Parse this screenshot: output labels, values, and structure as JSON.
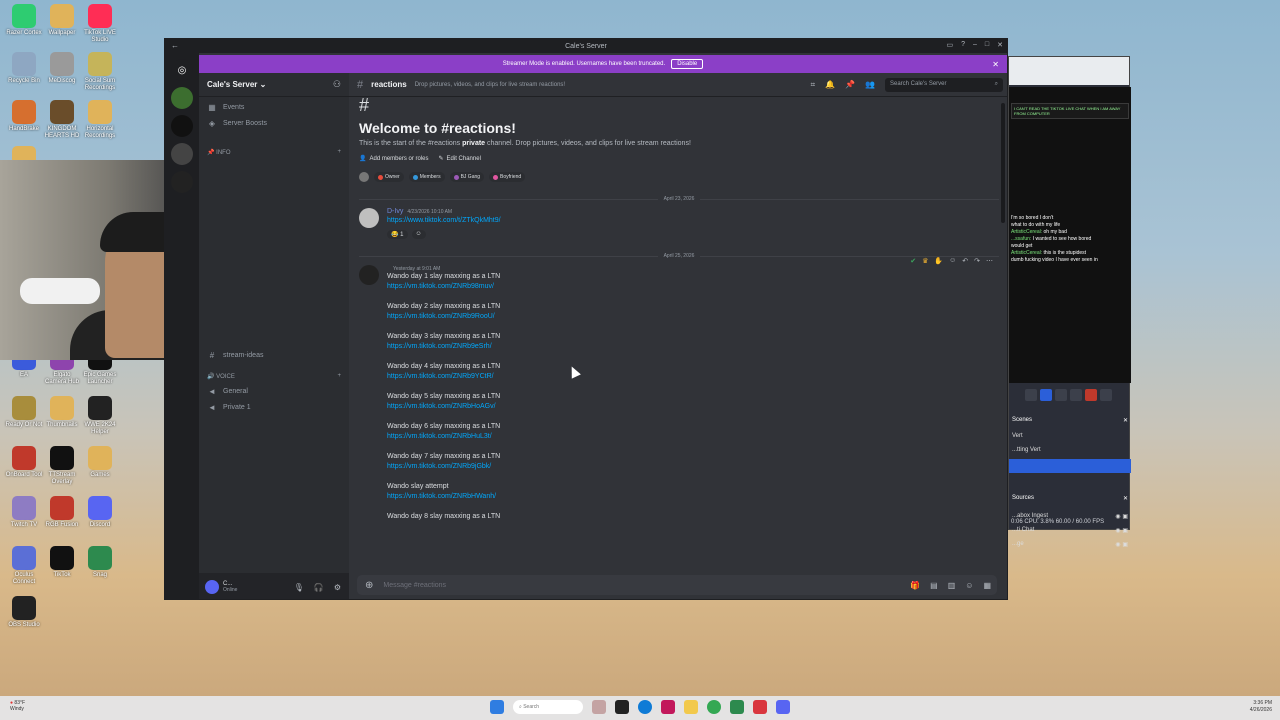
{
  "desktop": {
    "icons": [
      {
        "label": "Razer Cortex",
        "color": "#2ecc71"
      },
      {
        "label": "Wallpaper",
        "color": "#e0b35a"
      },
      {
        "label": "TikTok LIVE Studio",
        "color": "#ff2d55"
      },
      {
        "label": "Recycle Bin",
        "color": "#8ea7c2"
      },
      {
        "label": "MeDiscog",
        "color": "#9a9a9a"
      },
      {
        "label": "Social Sum Recordings",
        "color": "#c5b45a"
      },
      {
        "label": "HandBrake",
        "color": "#d66f2f"
      },
      {
        "label": "KINGDOM HEARTS HD",
        "color": "#6a4d2a"
      },
      {
        "label": "Horizontal Recordings",
        "color": "#e0b35a"
      },
      {
        "label": "Vertical Recordings",
        "color": "#e0b35a"
      },
      {
        "label": "EA",
        "color": "#3b5bdb"
      },
      {
        "label": "Elgato Camera Hub",
        "color": "#8e44ad"
      },
      {
        "label": "Epic Games Launcher",
        "color": "#111111"
      },
      {
        "label": "Ready Or Not",
        "color": "#a88d3c"
      },
      {
        "label": "Thumbnails",
        "color": "#e0b35a"
      },
      {
        "label": "WWE 2K24 Helper",
        "color": "#222222"
      },
      {
        "label": "OnBoard Tool",
        "color": "#c0392b"
      },
      {
        "label": "TTStream Overlay",
        "color": "#111111"
      },
      {
        "label": "Games",
        "color": "#e0b35a"
      },
      {
        "label": "Twitch TV",
        "color": "#8e7cc3"
      },
      {
        "label": "RGB Fusion",
        "color": "#c0392b"
      },
      {
        "label": "Discord",
        "color": "#5865f2"
      },
      {
        "label": "Oculus Connect",
        "color": "#5b6fd6"
      },
      {
        "label": "TikTok",
        "color": "#111111"
      },
      {
        "label": "Snag",
        "color": "#2d8a4e"
      },
      {
        "label": "OBS Studio",
        "color": "#222222"
      }
    ]
  },
  "obs": {
    "chat": [
      {
        "user": "",
        "text": "I'm so bored I don't"
      },
      {
        "user": "",
        "text": "what to do with my life"
      },
      {
        "user": "ArtisticCereal:",
        "text": "oh my bad"
      },
      {
        "user": "...ssafun:",
        "text": "I wanted to see how bored"
      },
      {
        "user": "",
        "text": "would get"
      },
      {
        "user": "ArtisticCereal:",
        "text": "this is the stupidest"
      },
      {
        "user": "",
        "text": "dumb fucking video I have ever seen in"
      }
    ],
    "banner": "I CAN'T READ THE TIKTOK LIVE CHAT WHEN I AM AWAY FROM COMPUTER",
    "scenes_title": "Scenes",
    "scenes": [
      "Vert",
      "...tting Vert",
      ""
    ],
    "sources_title": "Sources",
    "sources": [
      "...abox Ingest",
      "...ti Chat",
      "...ge"
    ],
    "stats": {
      "time": "0:06",
      "cpu": "CPU: 3.8%",
      "fps": "60.00 / 60.00 FPS"
    }
  },
  "discord": {
    "window_title": "Cale's Server",
    "streamer_banner": "Streamer Mode is enabled. Usernames have been truncated.",
    "disable_label": "Disable",
    "server_name": "Cale's Server",
    "channels": {
      "top": [
        {
          "icon": "calendar-icon",
          "glyph": "▦",
          "label": "Events"
        },
        {
          "icon": "boost-icon",
          "glyph": "◈",
          "label": "Server Boosts"
        }
      ],
      "info_category": "INFO",
      "text_items": [
        {
          "label": "stream-ideas"
        }
      ],
      "voice_category": "VOICE",
      "voice_items": [
        {
          "label": "General"
        },
        {
          "label": "Private 1"
        }
      ]
    },
    "user": {
      "name": "C...",
      "status": "Online"
    },
    "channel": {
      "name": "reactions",
      "topic": "Drop pictures, videos, and clips for live stream reactions!",
      "search_placeholder": "Search Cale's Server"
    },
    "welcome": {
      "title": "Welcome to #reactions!",
      "start_prefix": "This is the start of the #reactions ",
      "start_bold": "private",
      "start_suffix": " channel. Drop pictures, videos, and clips for live stream reactions!",
      "add_members": "Add members or roles",
      "edit_channel": "Edit Channel",
      "roles": [
        {
          "name": "Owner",
          "color": "#e74c3c"
        },
        {
          "name": "Members",
          "color": "#3498db"
        },
        {
          "name": "BJ Gang",
          "color": "#9b59b6"
        },
        {
          "name": "Boyfriend",
          "color": "#e056a0"
        }
      ]
    },
    "dividers": {
      "first": "April 23, 2026",
      "second": "April 25, 2026"
    },
    "first_message": {
      "author": "D-Ivy",
      "time": "4/23/2026 10:10 AM",
      "link": "https://www.tiktok.com/t/ZTkQkMht9/",
      "reactions": [
        "1"
      ]
    },
    "second_message": {
      "time": "Yesterday at 9:01 AM",
      "entries": [
        {
          "text": "Wando day 1 slay maxxing as a LTN",
          "link": "https://vm.tiktok.com/ZNRb98muv/"
        },
        {
          "text": "Wando day 2 slay maxxing as a LTN",
          "link": "https://vm.tiktok.com/ZNRb9RooU/"
        },
        {
          "text": "Wando day 3 slay maxxing as a LTN",
          "link": "https://vm.tiktok.com/ZNRb9eSrh/"
        },
        {
          "text": "Wando day 4 slay maxxing as a LTN",
          "link": "https://vm.tiktok.com/ZNRb9YCtR/"
        },
        {
          "text": "Wando day 5 slay maxxing as a LTN",
          "link": "https://vm.tiktok.com/ZNRbHoAGv/"
        },
        {
          "text": "Wando day 6 slay maxxing as a LTN",
          "link": "https://vm.tiktok.com/ZNRbHuL3t/"
        },
        {
          "text": "Wando day 7 slay maxxing as a LTN",
          "link": "https://vm.tiktok.com/ZNRb9jGbk/"
        },
        {
          "text": "Wando slay attempt",
          "link": "https://vm.tiktok.com/ZNRbHWanh/"
        },
        {
          "text": "Wando day 8 slay maxxing as a LTN",
          "link": ""
        }
      ]
    },
    "composer_placeholder": "Message #reactions"
  },
  "taskbar": {
    "weather_temp": "83°F",
    "weather_desc": "Windy",
    "search_label": "Search",
    "time": "3:36 PM",
    "date": "4/26/2026"
  }
}
